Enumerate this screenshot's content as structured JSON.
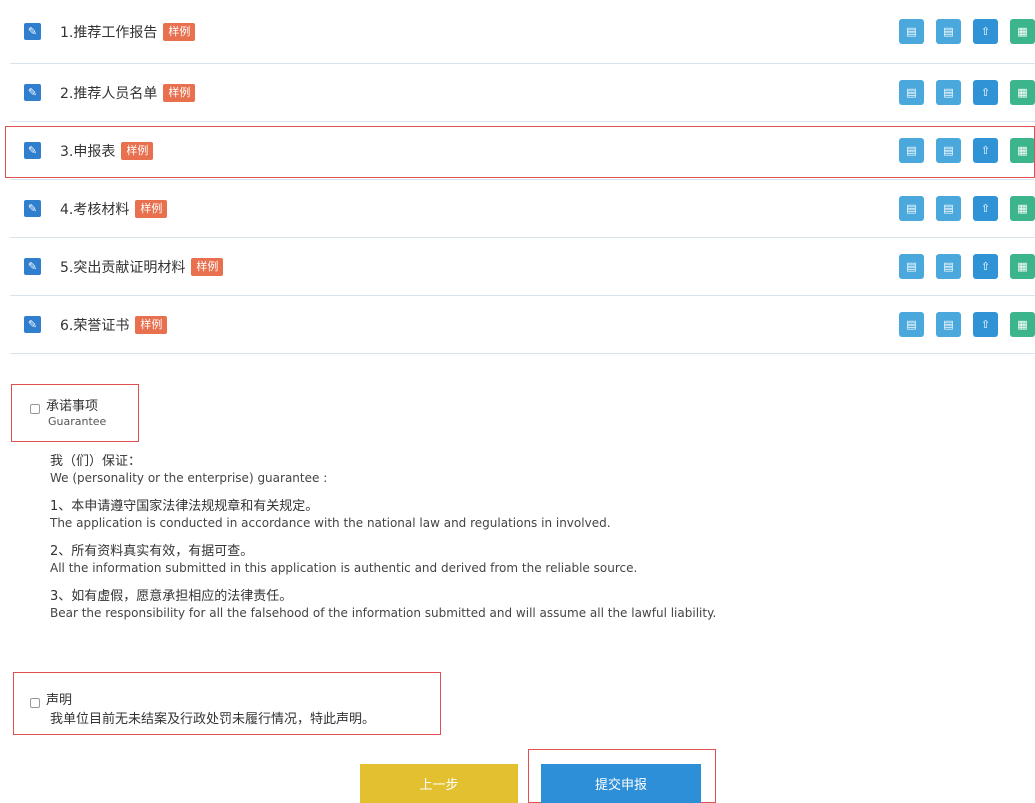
{
  "materials": {
    "items": [
      {
        "label": "1.推荐工作报告",
        "tag": "样例"
      },
      {
        "label": "2.推荐人员名单",
        "tag": "样例"
      },
      {
        "label": "3.申报表",
        "tag": "样例"
      },
      {
        "label": "4.考核材料",
        "tag": "样例"
      },
      {
        "label": "5.突出贡献证明材料",
        "tag": "样例"
      },
      {
        "label": "6.荣誉证书",
        "tag": "样例"
      }
    ],
    "icons": {
      "edit": "edit-icon",
      "doc1": "document-icon",
      "doc2": "document-icon",
      "upload": "upload-icon",
      "qr": "qr-code-icon"
    }
  },
  "guarantee": {
    "title": "承诺事项",
    "subtitle": "Guarantee",
    "intro_zh": "我（们）保证：",
    "intro_en": "We (personality or the enterprise) guarantee :",
    "terms": [
      {
        "zh": "1、本申请遵守国家法律法规规章和有关规定。",
        "en": "The application is conducted in accordance with the national law and regulations in involved."
      },
      {
        "zh": "2、所有资料真实有效，有据可查。",
        "en": "All the information submitted in this application is authentic and derived from the reliable source."
      },
      {
        "zh": "3、如有虚假，愿意承担相应的法律责任。",
        "en": "Bear the responsibility for all the falsehood of the information submitted and will assume all the lawful liability."
      }
    ]
  },
  "declaration": {
    "title": "声明",
    "text": "我单位目前无未结案及行政处罚未履行情况，特此声明。"
  },
  "buttons": {
    "prev": "上一步",
    "submit": "提交申报"
  },
  "colors": {
    "accent": "#2c8fd8",
    "tag": "#e8704f",
    "prev": "#e2c02f",
    "highlight": "#e15050"
  }
}
